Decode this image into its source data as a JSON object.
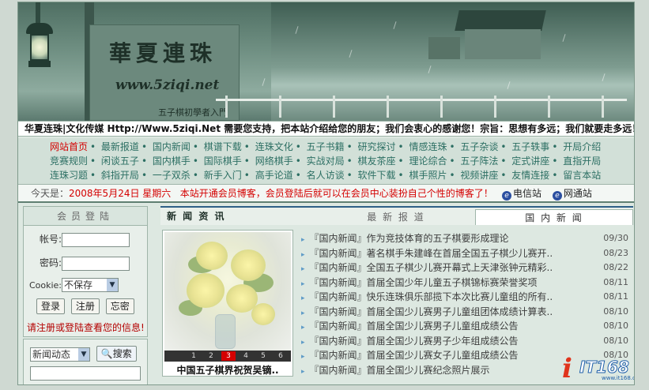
{
  "banner": {
    "title": "華夏連珠",
    "url": "www.5ziqi.net",
    "subtitle": "五子棋初學者入門"
  },
  "marquee": "华夏连珠|文化传媒 Http://Www.5ziqi.Net 需要您支持，把本站介绍给您的朋友；我们会衷心的感谢您！宗旨：思想有多远；我们就要走多远！",
  "nav": {
    "rows": [
      [
        "网站首页",
        "最新报道",
        "国内新闻",
        "棋谱下载",
        "连珠文化",
        "五子书籍",
        "研究探讨",
        "情感连珠",
        "五子杂谈",
        "五子轶事",
        "开局介绍"
      ],
      [
        "竞赛规则",
        "闲谈五子",
        "国内棋手",
        "国际棋手",
        "网络棋手",
        "实战对局",
        "棋友茶座",
        "理论综合",
        "五子阵法",
        "定式讲座",
        "直指开局"
      ],
      [
        "连珠习题",
        "斜指开局",
        "一子双杀",
        "新手入门",
        "高手论道",
        "名人访谈",
        "软件下载",
        "棋手照片",
        "视频讲座",
        "友情连接",
        "留言本站"
      ]
    ]
  },
  "datebar": {
    "prefix": "今天是：",
    "date": "2008年5月24日  星期六",
    "notice": "本站开通会员博客，会员登陆后就可以在会员中心装扮自己个性的博客了！",
    "telecom": "电信站",
    "netcom": "网通站"
  },
  "login": {
    "header": "会员登陆",
    "username_label": "帐号:",
    "password_label": "密码:",
    "cookie_label": "Cookie:",
    "cookie_value": "不保存",
    "login_btn": "登录",
    "register_btn": "注册",
    "forgot_btn": "忘密",
    "tip": "请注册或登陆查看您的信息!"
  },
  "search": {
    "category": "新闻动态",
    "button": "搜索"
  },
  "news": {
    "section_title": "新 闻 资 讯",
    "tab_latest": "最 新 报 道",
    "tab_domestic": "国 内 新 闻",
    "photo_caption": "中国五子棋界祝贺吴镝..",
    "pager": [
      "1",
      "2",
      "3",
      "4",
      "5",
      "6"
    ],
    "pager_active": 3,
    "items": [
      {
        "title": "『国内新闻』作为竞技体育的五子棋要形成理论",
        "date": "09/30"
      },
      {
        "title": "『国内新闻』著名棋手朱建峰在首届全国五子棋少儿赛开..",
        "date": "08/23"
      },
      {
        "title": "『国内新闻』全国五子棋少儿赛开幕式上天津张钟元精彩..",
        "date": "08/22"
      },
      {
        "title": "『国内新闻』首届全国少年儿童五子棋锦标赛荣誉奖项",
        "date": "08/11"
      },
      {
        "title": "『国内新闻』快乐连珠俱乐部揽下本次比赛儿童组的所有..",
        "date": "08/11"
      },
      {
        "title": "『国内新闻』首届全国少儿赛男子儿童组团体成绩计算表..",
        "date": "08/10"
      },
      {
        "title": "『国内新闻』首届全国少儿赛男子儿童组成绩公告",
        "date": "08/10"
      },
      {
        "title": "『国内新闻』首届全国少儿赛男子少年组成绩公告",
        "date": "08/10"
      },
      {
        "title": "『国内新闻』首届全国少儿赛女子儿童组成绩公告",
        "date": "08/10"
      },
      {
        "title": "『国内新闻』首届全国少儿赛纪念照片展示",
        "date": ""
      }
    ]
  },
  "watermark": {
    "text": "IT168",
    "small": "www.it168.com"
  },
  "colors": {
    "accent": "#2c6f63",
    "highlight": "#d40000",
    "tab_border": "#2d5f87"
  }
}
